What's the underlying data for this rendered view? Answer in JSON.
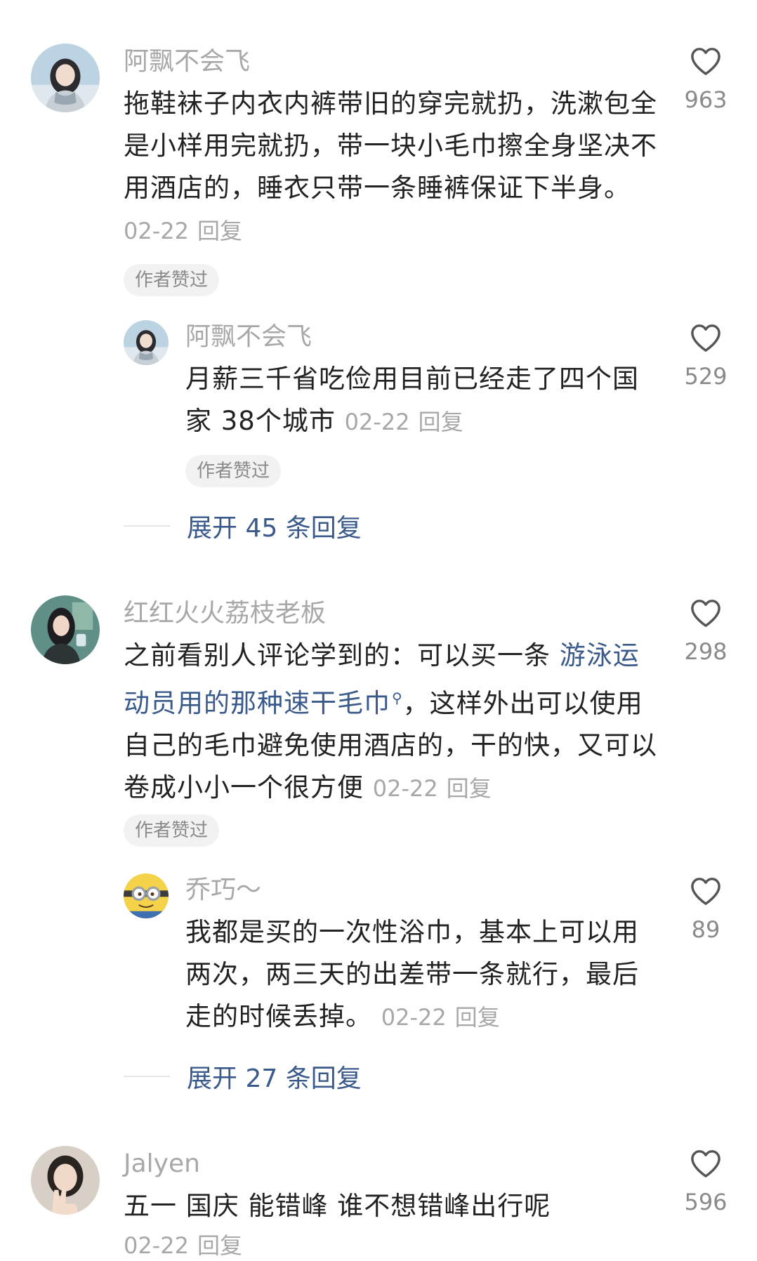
{
  "comments": [
    {
      "username": "阿飘不会飞",
      "text": "拖鞋袜子内衣内裤带旧的穿完就扔，洗漱包全是小样用完就扔，带一块小毛巾擦全身坚决不用酒店的，睡衣只带一条睡裤保证下半身。",
      "date": "02-22",
      "reply_label": "回复",
      "badge": "作者赞过",
      "likes": "963",
      "avatar_icon": "girl-avatar",
      "replies": [
        {
          "username": "阿飘不会飞",
          "text": "月薪三千省吃俭用目前已经走了四个国家 38个城市",
          "date": "02-22",
          "reply_label": "回复",
          "badge": "作者赞过",
          "likes": "529",
          "avatar_icon": "girl-avatar"
        }
      ],
      "expand_label": "展开 45 条回复"
    },
    {
      "username": "红红火火荔枝老板",
      "text_before_link": "之前看别人评论学到的：可以买一条 ",
      "link_text": "游泳运动员用的那种速干毛巾",
      "link_icon": "search-icon",
      "text_after_link": "，这样外出可以使用自己的毛巾避免使用酒店的，干的快，又可以卷成小小一个很方便",
      "date": "02-22",
      "reply_label": "回复",
      "badge": "作者赞过",
      "likes": "298",
      "avatar_icon": "woman-avatar",
      "replies": [
        {
          "username": "乔巧～",
          "text": "我都是买的一次性浴巾，基本上可以用两次，两三天的出差带一条就行，最后走的时候丢掉。",
          "date": "02-22",
          "reply_label": "回复",
          "likes": "89",
          "avatar_icon": "minion-avatar"
        }
      ],
      "expand_label": "展开 27 条回复"
    },
    {
      "username": "Jalyen",
      "text": "五一 国庆 能错峰 谁不想错峰出行呢",
      "date": "02-22",
      "reply_label": "回复",
      "likes": "596",
      "avatar_icon": "peace-sign-avatar"
    }
  ],
  "colors": {
    "link": "#3a5a8c",
    "meta": "#a8a8a8",
    "badge_bg": "#f2f2f2"
  }
}
